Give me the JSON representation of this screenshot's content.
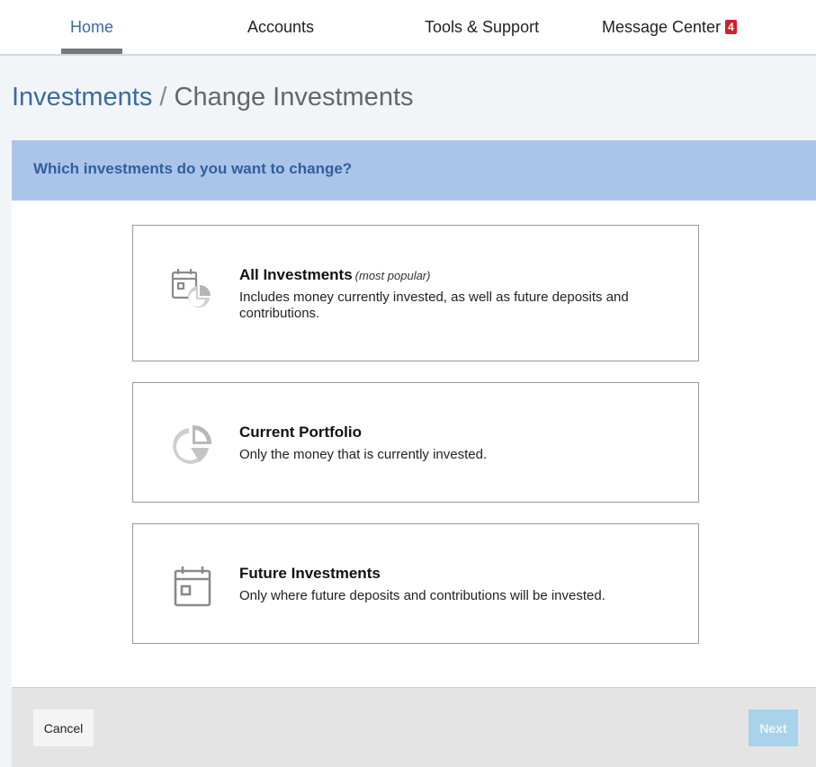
{
  "nav": {
    "home": "Home",
    "accounts": "Accounts",
    "tools": "Tools & Support",
    "messages": "Message Center",
    "message_count": "4"
  },
  "breadcrumb": {
    "parent": "Investments",
    "separator": " / ",
    "current": "Change Investments"
  },
  "question": "Which investments do you want to change?",
  "options": [
    {
      "title": "All Investments",
      "note": "(most popular)",
      "description": "Includes money currently invested, as well as future deposits and contributions.",
      "icon": "calendar-pie-icon"
    },
    {
      "title": "Current Portfolio",
      "description": "Only the money that is currently invested.",
      "icon": "pie-chart-icon"
    },
    {
      "title": "Future Investments",
      "description": "Only where future deposits and contributions will be invested.",
      "icon": "calendar-icon"
    }
  ],
  "footer": {
    "cancel": "Cancel",
    "next": "Next"
  },
  "colors": {
    "accent": "#3a6aa8",
    "question_bar": "#abc4ea",
    "badge": "#d21f2f",
    "next_disabled": "#a9d3ea"
  }
}
